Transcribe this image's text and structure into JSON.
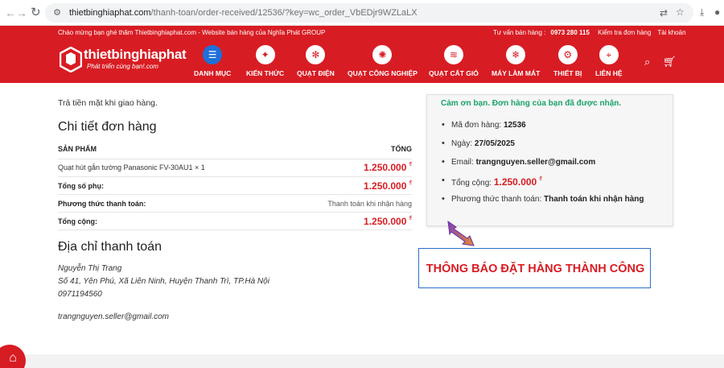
{
  "browser": {
    "url_host": "thietbinghiaphat.com",
    "url_path": "/thanh-toan/order-received/12536/?key=wc_order_VbEDjr9WZLaLX",
    "icons": [
      "back-icon",
      "forward-icon",
      "reload-icon",
      "site-info-icon",
      "translate-icon",
      "bookmark-star-icon",
      "download-icon",
      "profile-icon"
    ]
  },
  "header": {
    "welcome": "Chào mừng bạn ghé thăm Thietbinghiaphat.com - Website bán hàng của Nghĩa Phát GROUP",
    "consult_label": "Tư vấn bán hàng :",
    "phone": "0973 280 115",
    "track_order": "Kiểm tra đơn hàng",
    "account": "Tài khoản",
    "logo_text": "thietbinghiaphat",
    "logo_slogan": "Phát triển cùng bạn!",
    "logo_domain": ".com",
    "accent_color": "#d81c23",
    "menu": [
      {
        "label": "DANH MỤC",
        "icon": "menu-list-icon"
      },
      {
        "label": "KIẾN THỨC",
        "icon": "lightbulb-icon"
      },
      {
        "label": "QUẠT ĐIỆN",
        "icon": "fan-icon"
      },
      {
        "label": "QUẠT CÔNG NGHIỆP",
        "icon": "industrial-fan-icon"
      },
      {
        "label": "QUẠT CẮT GIÓ",
        "icon": "air-curtain-icon"
      },
      {
        "label": "MÁY LÀM MÁT",
        "icon": "air-cooler-icon"
      },
      {
        "label": "THIẾT BỊ",
        "icon": "device-icon"
      },
      {
        "label": "LIÊN HỆ",
        "icon": "location-pin-icon"
      }
    ]
  },
  "order": {
    "payment_note": "Trả tiền mặt khi giao hàng.",
    "details_title": "Chi tiết đơn hàng",
    "col_product": "SẢN PHẨM",
    "col_total": "TỔNG",
    "item_name": "Quạt hút gắn tường Panasonic FV-30AU1",
    "item_qty": "× 1",
    "item_price": "1.250.000",
    "currency": "₫",
    "subtotal_label": "Tổng số phụ:",
    "subtotal": "1.250.000",
    "payment_method_label": "Phương thức thanh toán:",
    "payment_method": "Thanh toán khi nhận hàng",
    "total_label": "Tổng cộng:",
    "total": "1.250.000"
  },
  "billing": {
    "title": "Địa chỉ thanh toán",
    "name": "Nguyễn Thị Trang",
    "address": "Số 41, Yên Phú, Xã Liên Ninh, Huyện Thanh Trì, TP.Hà Nội",
    "phone": "0971194560",
    "email": "trangnguyen.seller@gmail.com"
  },
  "confirmation": {
    "thanks": "Cảm ơn bạn. Đơn hàng của bạn đã được nhận.",
    "order_no_label": "Mã đơn hàng:",
    "order_no": "12536",
    "date_label": "Ngày:",
    "date": "27/05/2025",
    "email_label": "Email:",
    "email": "trangnguyen.seller@gmail.com",
    "total_label": "Tổng cộng:",
    "total": "1.250.000",
    "method_label": "Phương thức thanh toán:",
    "method": "Thanh toán khi nhận hàng"
  },
  "banner": {
    "success": "THÔNG BÁO ĐẶT HÀNG THÀNH CÔNG"
  }
}
